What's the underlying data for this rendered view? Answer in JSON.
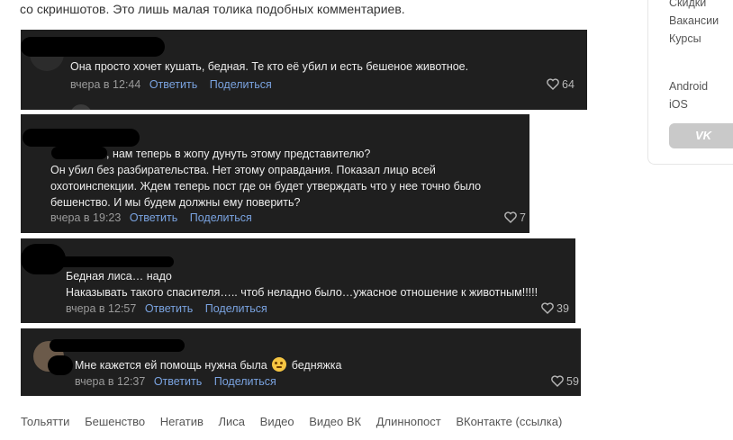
{
  "intro_text": "со скриншотов. Это лишь малая толика подобных комментариев.",
  "comments": [
    {
      "lines": [
        "Она просто хочет кушать, бедная. Те кто её убил и есть бешеное животное."
      ],
      "time": "вчера в 12:44",
      "reply": "Ответить",
      "share": "Поделиться",
      "likes": "64"
    },
    {
      "lines": [
        ", нам теперь в жопу дунуть этому представителю?",
        "Он убил без разбирательства. Нет этому оправдания. Показал лицо всей",
        "охотоинспекции. Ждем теперь пост где он будет утверждать что у нее точно было",
        "бешенство. И мы будем должны ему поверить?"
      ],
      "time": "вчера в 19:23",
      "reply": "Ответить",
      "share": "Поделиться",
      "likes": "7"
    },
    {
      "lines": [
        "Бедная лиса… надо",
        "Наказывать такого спасителя….. чтоб неладно было…ужасное отношение к животным!!!!!"
      ],
      "time": "вчера в 12:57",
      "reply": "Ответить",
      "share": "Поделиться",
      "likes": "39"
    },
    {
      "text_before_emoji": "Мне кажется ей помощь нужна была",
      "text_after_emoji": "бедняжка",
      "emoji_icon": "pleading-face-emoji",
      "time": "вчера в 12:37",
      "reply": "Ответить",
      "share": "Поделиться",
      "likes": "59"
    }
  ],
  "tags": [
    "Тольятти",
    "Бешенство",
    "Негатив",
    "Лиса",
    "Видео",
    "Видео ВК",
    "Длиннопост",
    "ВКонтакте (ссылка)"
  ],
  "sidebar": {
    "links_top": [
      "Скидки",
      "Вакансии",
      "Курсы"
    ],
    "links_apps": [
      "Android",
      "iOS"
    ],
    "vk_button_label": "VK"
  }
}
